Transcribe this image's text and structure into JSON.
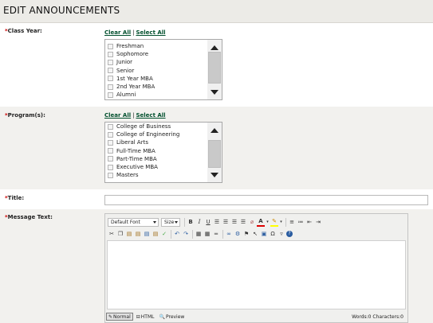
{
  "page": {
    "title": "EDIT ANNOUNCEMENTS"
  },
  "required_marker": "*",
  "class_year": {
    "label": "Class Year:",
    "clear_all": "Clear All",
    "select_all": "Select All",
    "separator": "|",
    "options": [
      "Freshman",
      "Sophomore",
      "Junior",
      "Senior",
      "1st Year MBA",
      "2nd Year MBA",
      "Alumni"
    ]
  },
  "programs": {
    "label": "Program(s):",
    "clear_all": "Clear All",
    "select_all": "Select All",
    "separator": "|",
    "options": [
      "College of Business",
      "College of Engineering",
      "Liberal Arts",
      "Full-Time MBA",
      "Part-Time MBA",
      "Executive MBA",
      "Masters"
    ]
  },
  "title_field": {
    "label": "Title:",
    "value": ""
  },
  "message": {
    "label": "Message Text:",
    "toolbar": {
      "font": "Default Font",
      "size": "Size",
      "row1_icons": [
        "bold-icon",
        "italic-icon",
        "underline-icon",
        "align-left-icon",
        "align-center-icon",
        "align-right-icon",
        "justify-icon",
        "eraser-icon",
        "font-color-icon",
        "highlight-color-icon",
        "ordered-list-icon",
        "unordered-list-icon",
        "outdent-icon",
        "indent-icon"
      ],
      "row2_icons": [
        "cut-icon",
        "copy-icon",
        "paste-icon",
        "paste-text-icon",
        "paste-word-icon",
        "paste-html-icon",
        "spellcheck-icon",
        "undo-icon",
        "redo-icon",
        "table-icon",
        "insert-table-icon",
        "horizontal-rule-icon",
        "link-icon",
        "unlink-icon",
        "anchor-icon",
        "select-icon",
        "image-icon",
        "special-char-icon",
        "format-stripper-icon",
        "help-icon"
      ]
    },
    "modes": {
      "normal": "Normal",
      "html": "HTML",
      "preview": "Preview"
    },
    "counts": "Words:0 Characters:0"
  }
}
